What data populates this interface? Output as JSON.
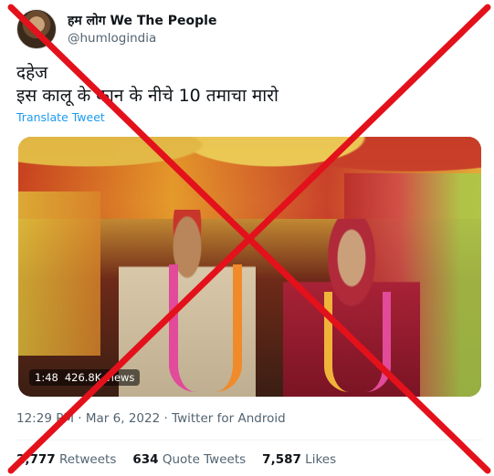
{
  "author": {
    "display_name": "हम लोग We The People",
    "handle": "@humlogindia",
    "avatar_icon": "profile-avatar"
  },
  "tweet": {
    "text_line1": "दहेज",
    "text_line2": "इस कालू के कान के नीचे 10 तमाचा मारो",
    "translate_label": "Translate Tweet"
  },
  "media": {
    "duration": "1:48",
    "views": "426.8K views"
  },
  "meta": {
    "time": "12:29 PM",
    "date": "Mar 6, 2022",
    "source": "Twitter for Android",
    "separator": "·"
  },
  "stats": {
    "retweets_count": "2,777",
    "retweets_label": "Retweets",
    "quotes_count": "634",
    "quotes_label": "Quote Tweets",
    "likes_count": "7,587",
    "likes_label": "Likes"
  },
  "colors": {
    "cross": "#e3111b",
    "link": "#1d9bf0",
    "muted": "#536471"
  }
}
